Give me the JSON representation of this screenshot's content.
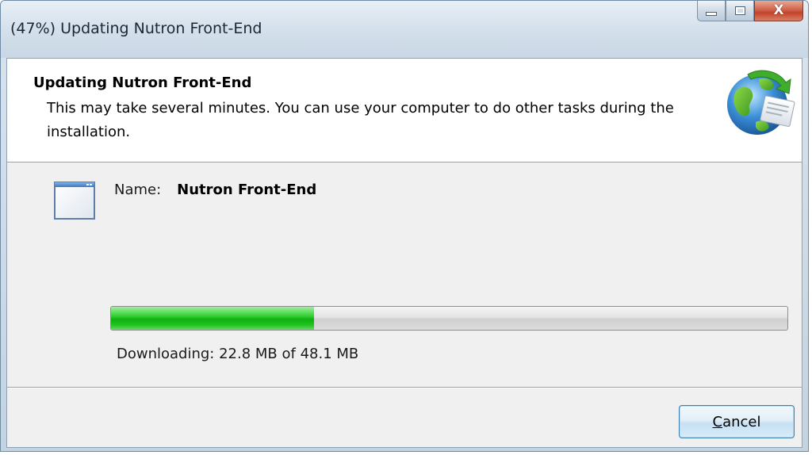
{
  "window": {
    "title": "(47%) Updating Nutron Front-End"
  },
  "caption_buttons": {
    "minimize_icon": "minimize-icon",
    "maximize_icon": "maximize-icon",
    "close_icon": "close-icon",
    "close_glyph": "X"
  },
  "header": {
    "title": "Updating Nutron Front-End",
    "description": "This may take several minutes. You can use your computer to do other tasks during the installation.",
    "icon": "globe-update-icon"
  },
  "item": {
    "icon": "application-window-icon",
    "name_label": "Name:",
    "name_value": "Nutron Front-End"
  },
  "progress": {
    "fraction": 0.3,
    "status": "Downloading: 22.8 MB of 48.1 MB"
  },
  "buttons": {
    "cancel_accel": "C",
    "cancel_rest": "ancel"
  },
  "colors": {
    "progress_fill": "#1fbf1f",
    "close_button": "#c94a31",
    "button_border": "#3c7fb1"
  }
}
